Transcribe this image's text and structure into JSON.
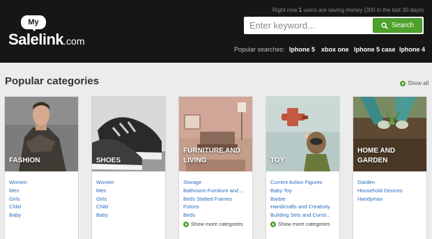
{
  "header": {
    "status": {
      "prefix": "Right now",
      "count": "1",
      "suffix": "users are saving money (300 in the last 30 days)"
    },
    "logo": {
      "top": "My",
      "main": "Salelink",
      "domain": ".com"
    },
    "search": {
      "placeholder": "Enter keyword...",
      "button_label": "Search"
    },
    "popular": {
      "label": "Popular searches:",
      "terms": [
        "Iphone 5",
        "xbox one",
        "Iphone 5 case",
        "Iphone 4"
      ]
    }
  },
  "main": {
    "title": "Popular categories",
    "show_all": "Show all",
    "categories": [
      {
        "title": "FASHION",
        "links": [
          "Women",
          "Men",
          "Girls",
          "Child",
          "Baby"
        ]
      },
      {
        "title": "SHOES",
        "links": [
          "Women",
          "Men",
          "Girls",
          "Child",
          "Baby"
        ]
      },
      {
        "title": "FURNITURE AND LIVING",
        "links": [
          "Storage",
          "Bathroom Furniture and ...",
          "Beds Slatted Frames",
          "Futons",
          "Beds"
        ],
        "more": "Show more categories"
      },
      {
        "title": "TOY",
        "links": [
          "Current Action Figures",
          "Baby Toy",
          "Barbie",
          "Handicrafts and Creativity",
          "Building Sets and Const..."
        ],
        "more": "Show more categories"
      },
      {
        "title": "HOME AND GARDEN",
        "links": [
          "Garden",
          "Household Devices",
          "Handyman"
        ]
      }
    ]
  },
  "colors": {
    "header_bg": "#161616",
    "accent_green": "#4ea22b",
    "link_blue": "#2a6dbe",
    "page_bg": "#ececec"
  },
  "icons": {
    "search": "magnifier-icon",
    "more": "green-arrow-circle-icon"
  }
}
